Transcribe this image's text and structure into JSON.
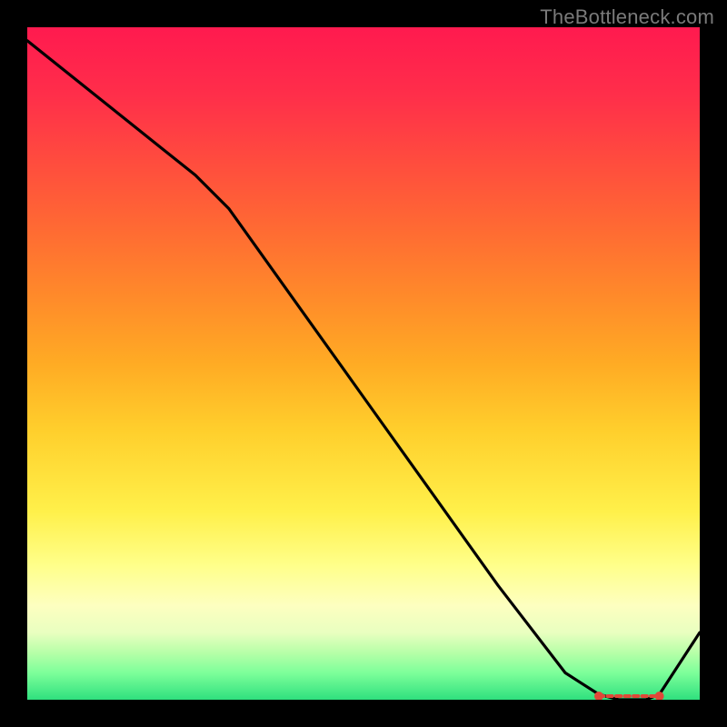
{
  "attribution": "TheBottleneck.com",
  "chart_data": {
    "type": "line",
    "title": "",
    "xlabel": "",
    "ylabel": "",
    "xlim": [
      0,
      100
    ],
    "ylim": [
      0,
      100
    ],
    "series": [
      {
        "name": "curve",
        "x": [
          0,
          10,
          20,
          25,
          30,
          40,
          50,
          60,
          70,
          80,
          85,
          88,
          90,
          92,
          94,
          100
        ],
        "values": [
          98,
          90,
          82,
          78,
          73,
          59,
          45,
          31,
          17,
          4,
          0.8,
          0,
          0,
          0,
          0.8,
          10
        ]
      }
    ],
    "optimum_marker": {
      "x_range": [
        85,
        94
      ],
      "y": 0
    },
    "background_gradient": {
      "top": "#ff1a4f",
      "bottom": "#2fe07e"
    }
  }
}
